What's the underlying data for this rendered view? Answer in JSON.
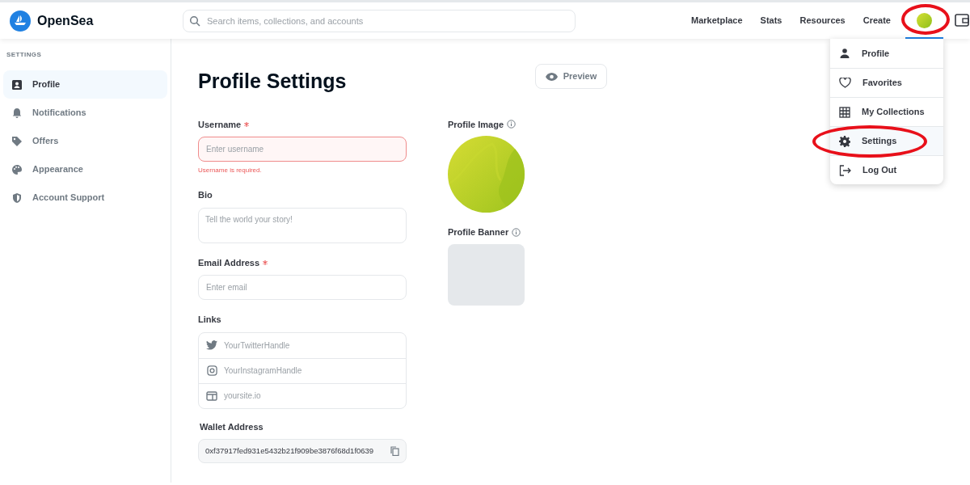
{
  "header": {
    "logo": "OpenSea",
    "search": {
      "placeholder": "Search items, collections, and accounts"
    },
    "nav": [
      {
        "label": "Marketplace"
      },
      {
        "label": "Stats"
      },
      {
        "label": "Resources"
      },
      {
        "label": "Create"
      }
    ],
    "avatar": {
      "selected": true,
      "highlighted": true
    }
  },
  "sidebar": {
    "heading": "SETTINGS",
    "items": [
      {
        "label": "Profile",
        "kind": "profile",
        "selected": true
      },
      {
        "label": "Notifications",
        "kind": "bell",
        "selected": false
      },
      {
        "label": "Offers",
        "kind": "tag",
        "selected": false
      },
      {
        "label": "Appearance",
        "kind": "palette",
        "selected": false
      },
      {
        "label": "Account Support",
        "kind": "shield",
        "selected": false
      }
    ]
  },
  "main": {
    "title": "Profile Settings",
    "preview_button": "Preview",
    "username": {
      "label": "Username",
      "required": true,
      "placeholder": "Enter username",
      "error": "Username is required."
    },
    "bio": {
      "label": "Bio",
      "placeholder": "Tell the world your story!"
    },
    "email": {
      "label": "Email Address",
      "required": true,
      "placeholder": "Enter email"
    },
    "links": {
      "label": "Links",
      "items": [
        {
          "kind": "twitter",
          "placeholder": "YourTwitterHandle"
        },
        {
          "kind": "instagram",
          "placeholder": "YourInstagramHandle"
        },
        {
          "kind": "website",
          "placeholder": "yoursite.io"
        }
      ]
    },
    "wallet": {
      "label": "Wallet Address",
      "value": "0xf37917fed931e5432b21f909be3876f68d1f0639"
    },
    "profile_image": {
      "label": "Profile Image"
    },
    "profile_banner": {
      "label": "Profile Banner"
    }
  },
  "menu": {
    "items": [
      {
        "label": "Profile",
        "kind": "person",
        "highlighted": false
      },
      {
        "label": "Favorites",
        "kind": "heart",
        "highlighted": false
      },
      {
        "label": "My Collections",
        "kind": "grid",
        "highlighted": false
      },
      {
        "label": "Settings",
        "kind": "gear",
        "highlighted": true
      },
      {
        "label": "Log Out",
        "kind": "logout",
        "highlighted": false
      }
    ]
  }
}
